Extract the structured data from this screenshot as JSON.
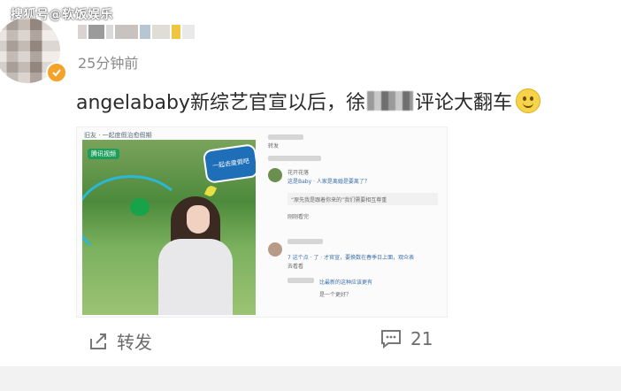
{
  "watermark": "搜狐号@软饭娱乐",
  "post": {
    "time": "25分钟前",
    "text_before": "angelababy新综艺官宣以后，徐",
    "text_after": "评论大翻车"
  },
  "embedded_image": {
    "caption": "旧友 · 一起度假治愈假期",
    "photo_tag": "腾讯视频",
    "show_logo": "一起去度假吧"
  },
  "comments": {
    "reply_action": "转发",
    "c1_name": "花开花落",
    "c1_text": "这是Baby · 人家是离婚是要离了？",
    "c1_quote": "“原先我是跟着你来的”我们需要相互尊重",
    "c1_tail": "刚刚看完",
    "c2_text": "7 这个点 · 了 · 才官宣，要换数在春季日上面，观众表",
    "c2_tail": "去看看",
    "c3_text": "比最新的这种应该更有",
    "c3_tail": "是一个更好？"
  },
  "actions": {
    "share_label": "转发",
    "comment_count": "21"
  },
  "colors": {
    "vip_badge": "#f3a32a",
    "time_text": "#8a8a8a"
  }
}
